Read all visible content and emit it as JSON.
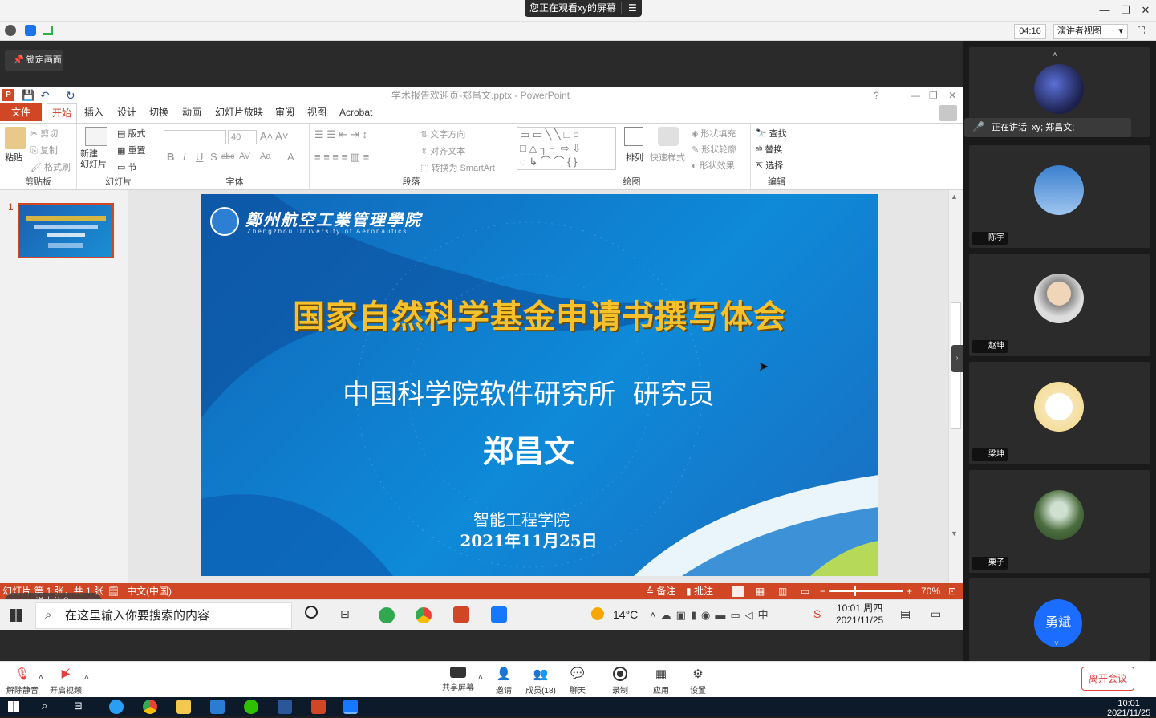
{
  "top": {
    "watching": "您正在观看xy的屏幕",
    "timer": "04:16",
    "view_mode": "演讲者视图",
    "lock_screen": "锁定画面"
  },
  "ppt": {
    "window_title": "学术报告欢迎页-郑昌文.pptx - PowerPoint",
    "tabs": [
      "文件",
      "开始",
      "插入",
      "设计",
      "切换",
      "动画",
      "幻灯片放映",
      "审阅",
      "视图",
      "Acrobat"
    ],
    "clipboard": {
      "paste": "粘贴",
      "cut": "剪切",
      "copy": "复制",
      "format_painter": "格式刷",
      "label": "剪贴板"
    },
    "slides_group": {
      "new_slide": "新建\n幻灯片",
      "layout": "版式",
      "reset": "重置",
      "section": "节",
      "label": "幻灯片"
    },
    "font_group": {
      "size": "40",
      "label": "字体"
    },
    "paragraph_group": {
      "text_direction": "文字方向",
      "align_text": "对齐文本",
      "smartart": "转换为 SmartArt",
      "label": "段落"
    },
    "drawing_group": {
      "arrange": "排列",
      "quick_styles": "快速样式",
      "shape_fill": "形状填充",
      "shape_outline": "形状轮廓",
      "shape_effects": "形状效果",
      "label": "绘图"
    },
    "editing_group": {
      "find": "查找",
      "replace": "替换",
      "select": "选择",
      "label": "编辑"
    },
    "thumb_number": "1",
    "slide": {
      "school_cn": "鄭州航空工業管理學院",
      "school_en": "Zhengzhou University of Aeronautics",
      "title": "国家自然科学基金申请书撰写体会",
      "affiliation": "中国科学院软件研究所  研究员",
      "speaker": "郑昌文",
      "college": "智能工程学院",
      "date": "2021年11月25日"
    },
    "status": {
      "slide_info": "幻灯片 第 1 张，共 1 张",
      "language": "中文(中国)",
      "notes": "备注",
      "comments": "批注",
      "zoom": "70%",
      "chat_hint": "说点什么..."
    }
  },
  "taskbar_shared": {
    "search_placeholder": "在这里输入你要搜索的内容",
    "temperature": "14°C",
    "time": "10:01 周四",
    "date": "2021/11/25"
  },
  "participants": {
    "speaking": "正在讲话: xy; 郑昌文;",
    "tiles": [
      {
        "name": "陈宇"
      },
      {
        "name": "赵坤"
      },
      {
        "name": "梁坤"
      },
      {
        "name": "栗子"
      },
      {
        "name": "",
        "avatar_text": "勇斌"
      }
    ]
  },
  "meeting_bar": {
    "mute": "解除静音",
    "video": "开启视频",
    "share": "共享屏幕",
    "invite": "邀请",
    "members": "成员(18)",
    "chat": "聊天",
    "record": "录制",
    "apps": "应用",
    "settings": "设置",
    "leave": "离开会议"
  },
  "taskbar_local": {
    "time": "10:01",
    "date": "2021/11/25"
  },
  "colors": {
    "ppt_accent": "#d14624",
    "slide_blue": "#1166b8",
    "title_yellow": "#f6c12b",
    "leave_red": "#e04040"
  }
}
